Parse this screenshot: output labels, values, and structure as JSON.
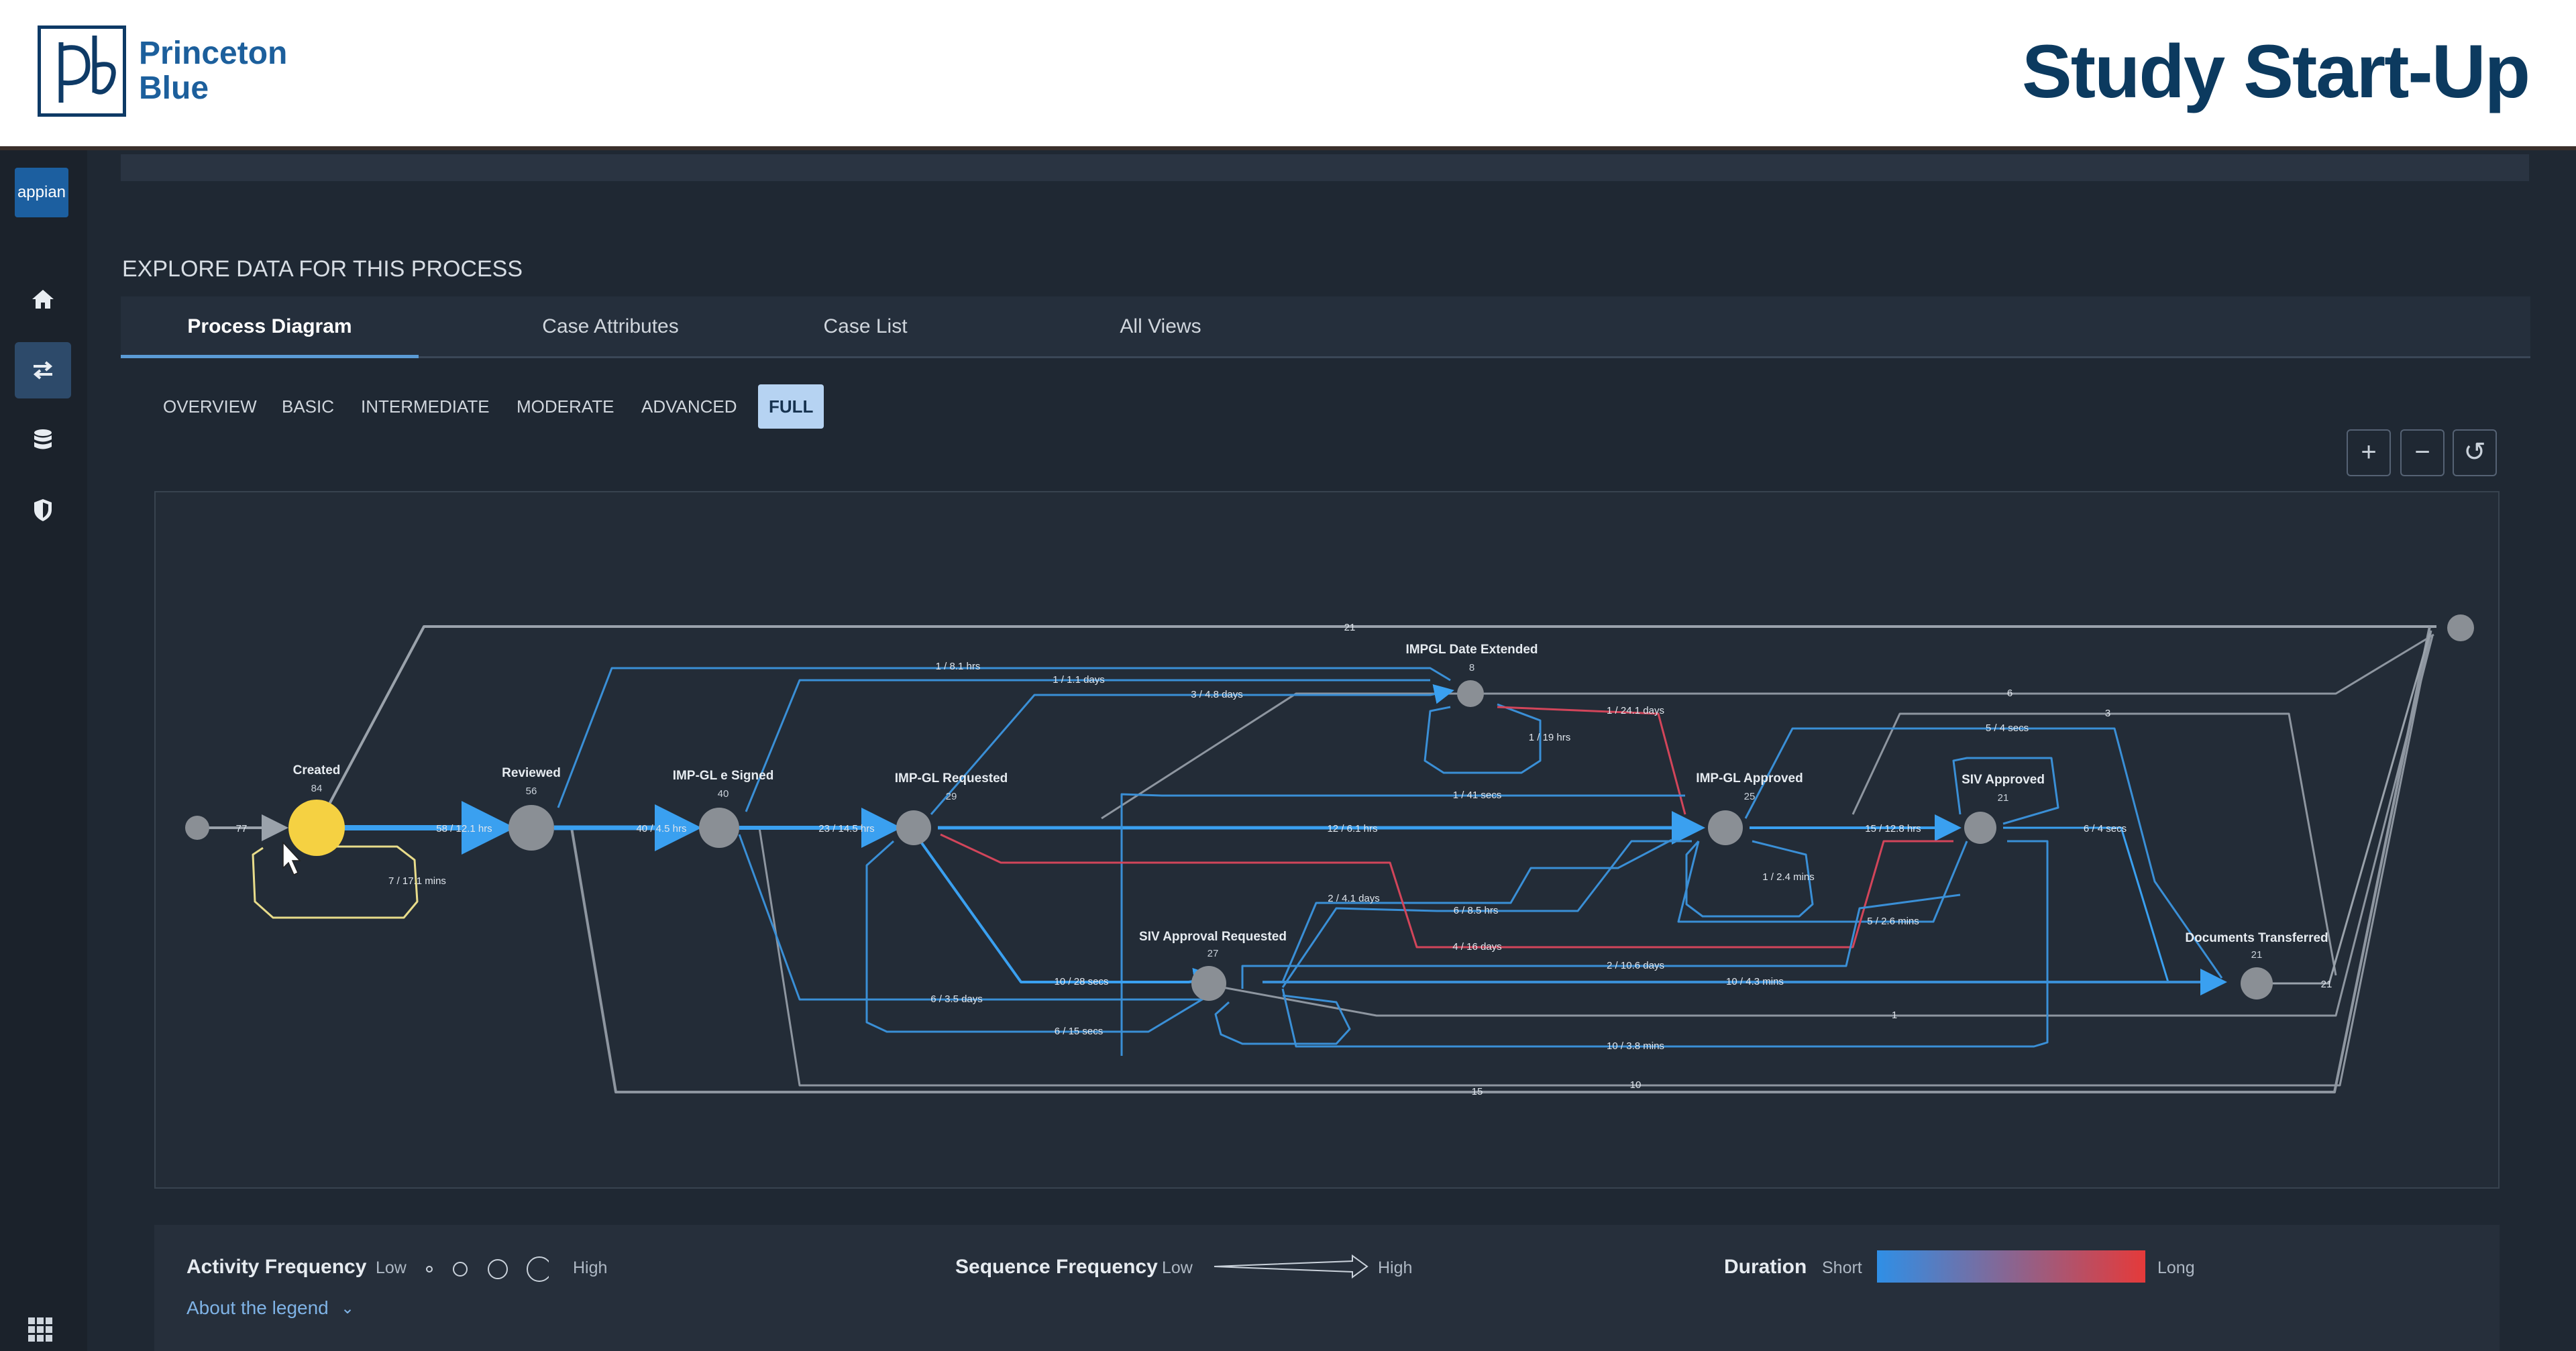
{
  "header": {
    "logo_line1": "Princeton",
    "logo_line2": "Blue",
    "title": "Study Start-Up"
  },
  "sidebar": {
    "badge": "appian",
    "items": [
      {
        "icon": "home-icon"
      },
      {
        "icon": "process-icon",
        "active": true
      },
      {
        "icon": "database-icon"
      },
      {
        "icon": "shield-icon"
      }
    ],
    "bottom_icon": "app-grid-icon"
  },
  "section_title": "EXPLORE DATA FOR THIS PROCESS",
  "tabs": [
    {
      "label": "Process Diagram",
      "active": true
    },
    {
      "label": "Case Attributes"
    },
    {
      "label": "Case List"
    },
    {
      "label": "All Views"
    }
  ],
  "levels": [
    "OVERVIEW",
    "BASIC",
    "INTERMEDIATE",
    "MODERATE",
    "ADVANCED",
    "FULL"
  ],
  "active_level": "FULL",
  "zoom_controls": {
    "zoom_in": "+",
    "zoom_out": "−",
    "reset": "↺"
  },
  "diagram": {
    "nodes": [
      {
        "id": "created",
        "name": "Created",
        "count": "84"
      },
      {
        "id": "reviewed",
        "name": "Reviewed",
        "count": "56"
      },
      {
        "id": "esigned",
        "name": "IMP-GL e Signed",
        "count": "40"
      },
      {
        "id": "requested",
        "name": "IMP-GL Requested",
        "count": "29"
      },
      {
        "id": "extended",
        "name": "IMPGL Date Extended",
        "count": "8"
      },
      {
        "id": "approved",
        "name": "IMP-GL Approved",
        "count": "25"
      },
      {
        "id": "siv_req",
        "name": "SIV Approval Requested",
        "count": "27"
      },
      {
        "id": "siv_app",
        "name": "SIV Approved",
        "count": "21"
      },
      {
        "id": "docs",
        "name": "Documents Transferred",
        "count": "21"
      }
    ],
    "edge_labels": {
      "start_in": "77",
      "created_self": "7 / 17.1 mins",
      "created_reviewed": "58 / 12.1 hrs",
      "reviewed_esigned": "40 / 4.5 hrs",
      "esigned_requested": "23 / 14.5 hrs",
      "requested_approved": "12 / 6.1 hrs",
      "approved_sivapp": "15 / 12.8 hrs",
      "sivapp_docs": "6 / 4 secs",
      "docs_end": "21",
      "top_bypass": "21",
      "to_ext_1": "1 / 8.1 hrs",
      "to_ext_2": "1 / 1.1 days",
      "to_ext_3": "3 / 4.8 days",
      "ext_self": "1 / 19 hrs",
      "ext_approved": "1 / 24.1 days",
      "r6": "6",
      "r3": "3",
      "r54": "5 / 4 secs",
      "r141": "1 / 41 secs",
      "appr_self": "1 / 2.4 mins",
      "r526": "5 / 2.6 mins",
      "r241": "2 / 4.1 days",
      "r685": "6 / 8.5 hrs",
      "r416": "4 / 16 days",
      "r2108": "2 / 10.6 days",
      "r1043": "10 / 4.3 mins",
      "r1028": "10 / 28 secs",
      "r635": "6 / 3.5 days",
      "r615": "6 / 15 secs",
      "r1": "1",
      "r1038": "10 / 3.8 mins",
      "r10": "10",
      "r15": "15"
    }
  },
  "legend": {
    "activity_title": "Activity Frequency",
    "low": "Low",
    "high": "High",
    "sequence_title": "Sequence Frequency",
    "duration_title": "Duration",
    "short": "Short",
    "long": "Long",
    "about": "About the legend",
    "gradient_start": "#2f8fe6",
    "gradient_end": "#e53a3a"
  },
  "colors": {
    "accent": "#5b9bd5",
    "node": "#8a8f95",
    "start_node": "#f5d142",
    "edge_blue": "#3aa0f0",
    "edge_red": "#d2455a",
    "edge_gray": "#9aa2ab"
  }
}
